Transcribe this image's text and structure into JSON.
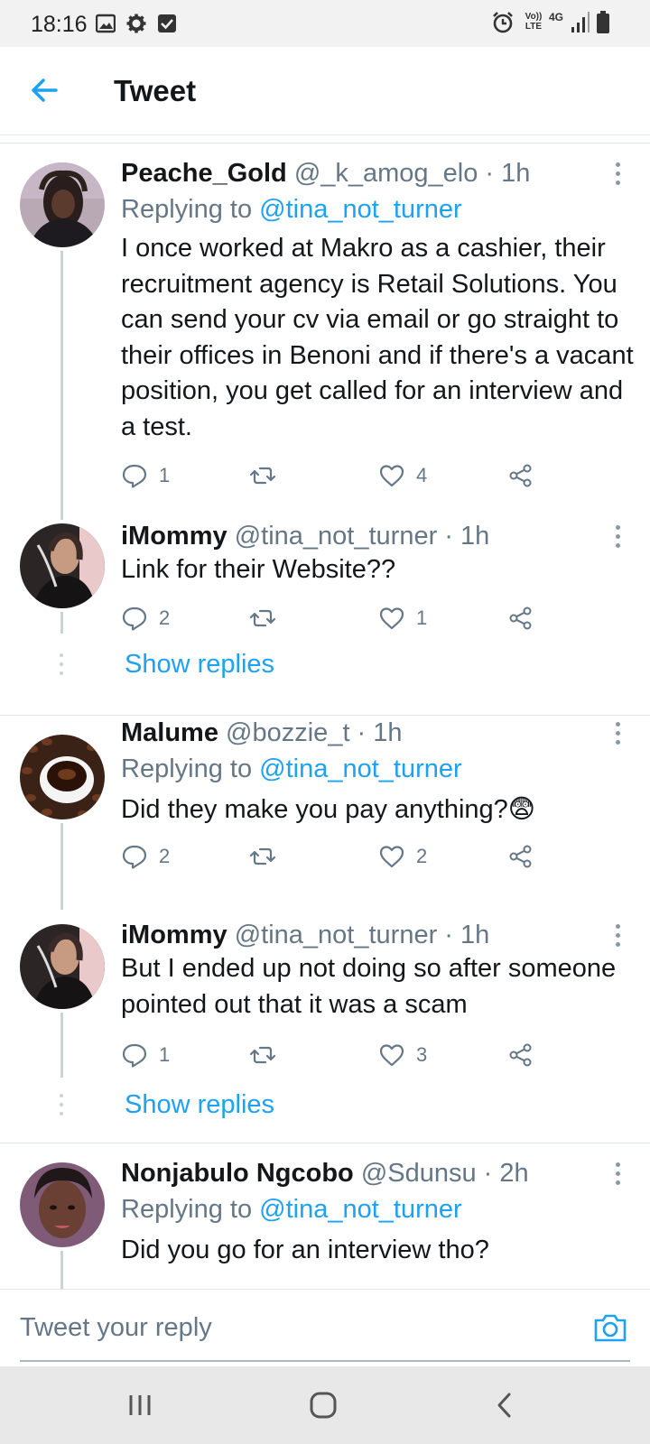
{
  "status_bar": {
    "time": "18:16",
    "lte_label": "Vo)) LTE",
    "network": "4G"
  },
  "header": {
    "title": "Tweet"
  },
  "tweets": [
    {
      "name": "Peache_Gold",
      "handle": "@_k_amog_elo · 1h",
      "replying_prefix": "Replying to",
      "replying_to": "@tina_not_turner",
      "text": "I once worked at Makro as a cashier, their recruitment agency is Retail Solutions. You can send your cv via email or go straight to their offices in Benoni and if there's a vacant position,  you get called for an interview and a test.",
      "replies": "1",
      "retweets": "",
      "likes": "4"
    },
    {
      "name": "iMommy",
      "handle": "@tina_not_turner · 1h",
      "text": "Link for their Website??",
      "replies": "2",
      "retweets": "",
      "likes": "1"
    },
    {
      "name": "Malume",
      "handle": "@bozzie_t · 1h",
      "replying_prefix": "Replying to",
      "replying_to": "@tina_not_turner",
      "text": "Did they make you pay anything?😨",
      "replies": "2",
      "retweets": "",
      "likes": "2"
    },
    {
      "name": "iMommy",
      "handle": "@tina_not_turner · 1h",
      "text": "But I ended up not doing so after someone pointed out that it was a scam",
      "replies": "1",
      "retweets": "",
      "likes": "3"
    },
    {
      "name": "Nonjabulo Ngcobo",
      "handle": "@Sdunsu · 2h",
      "replying_prefix": "Replying to",
      "replying_to": "@tina_not_turner",
      "text": "Did you go for an interview tho?"
    }
  ],
  "show_replies_label": "Show replies",
  "reply_bar": {
    "placeholder": "Tweet your reply"
  },
  "icons": {
    "back": "arrow-left-icon",
    "reply": "speech-bubble-icon",
    "retweet": "retweet-icon",
    "like": "heart-icon",
    "share": "share-icon",
    "more": "vertical-dots-icon",
    "camera": "camera-icon"
  },
  "colors": {
    "accent": "#1da1f2",
    "secondary_text": "#657786",
    "primary_text": "#14171a"
  }
}
